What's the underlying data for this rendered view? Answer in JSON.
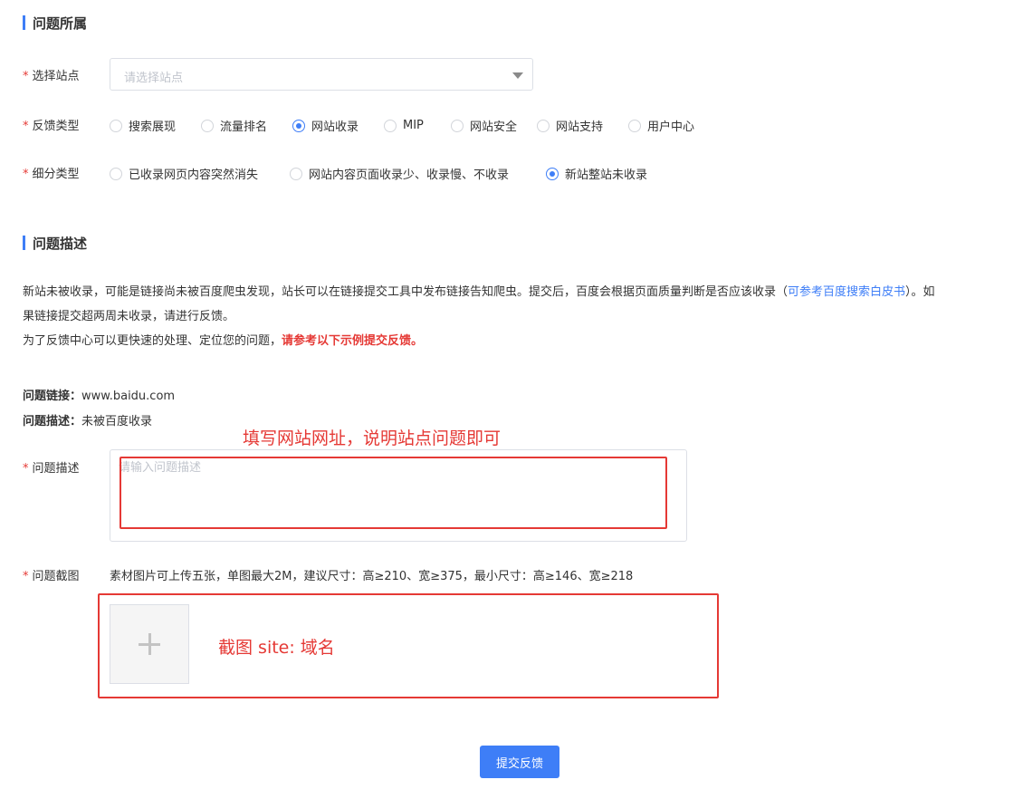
{
  "section1": {
    "title": "问题所属"
  },
  "site_select": {
    "label": "选择站点",
    "placeholder": "请选择站点"
  },
  "feedback_type": {
    "label": "反馈类型",
    "options": [
      "搜索展现",
      "流量排名",
      "网站收录",
      "MIP",
      "网站安全",
      "网站支持",
      "用户中心"
    ],
    "selected": "网站收录"
  },
  "sub_type": {
    "label": "细分类型",
    "options": [
      "已收录网页内容突然消失",
      "网站内容页面收录少、收录慢、不收录",
      "新站整站未收录"
    ],
    "selected": "新站整站未收录"
  },
  "section2": {
    "title": "问题描述"
  },
  "description": {
    "line1_a": "新站未被收录，可能是链接尚未被百度爬虫发现，站长可以在链接提交工具中发布链接告知爬虫。提交后，百度会根据页面质量判断是否应该收录（",
    "line1_link": "可参考百度搜索白皮书",
    "line1_b": "）。如",
    "line2": "果链接提交超两周未收录，请进行反馈。",
    "line3_a": "为了反馈中心可以更快速的处理、定位您的问题，",
    "line3_red": "请参考以下示例提交反馈。"
  },
  "example": {
    "link_label": "问题链接：",
    "link_value": "www.baidu.com",
    "desc_label": "问题描述：",
    "desc_value": "未被百度收录"
  },
  "annotations": {
    "desc_hint": "填写网站网址，说明站点问题即可",
    "screenshot_hint": "截图 site: 域名",
    "color": "#e53935"
  },
  "desc_field": {
    "label": "问题描述",
    "placeholder": "请输入问题描述"
  },
  "screenshot_field": {
    "label": "问题截图",
    "hint": "素材图片可上传五张，单图最大2M，建议尺寸：高≥210、宽≥375，最小尺寸：高≥146、宽≥218"
  },
  "submit": {
    "label": "提交反馈"
  },
  "colors": {
    "accent": "#3e7ef7",
    "required": "#e53935"
  }
}
